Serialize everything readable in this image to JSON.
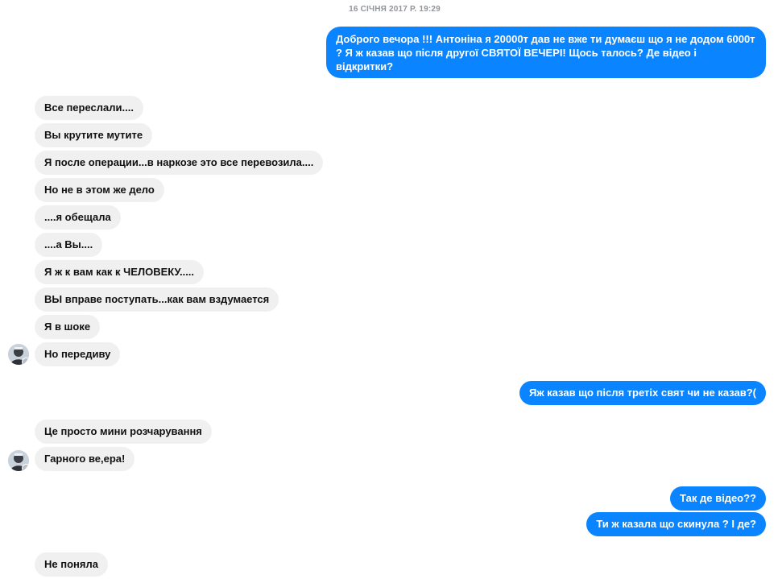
{
  "conversation": {
    "timestamp": "16 СІЧНЯ 2017 Р. 19:29",
    "messages": [
      {
        "from": "me",
        "text": "Доброго вечора !!! Антоніна я 20000т дав не вже ти думаєш що я не додом 6000т ? Я ж казав що після другої СВЯТОЇ ВЕЧЕРІ! Щось талось? Де відео і відкритки?"
      },
      {
        "from": "contact",
        "text": "Все переслали...."
      },
      {
        "from": "contact",
        "text": "Вы крутите мутите"
      },
      {
        "from": "contact",
        "text": "Я после операции...в наркозе это все перевозила...."
      },
      {
        "from": "contact",
        "text": "Но не в этом же дело"
      },
      {
        "from": "contact",
        "text": "....я обещала"
      },
      {
        "from": "contact",
        "text": "....а Вы...."
      },
      {
        "from": "contact",
        "text": "Я ж к вам как к ЧЕЛОВЕКУ....."
      },
      {
        "from": "contact",
        "text": "ВЫ вправе поступать...как вам вздумается"
      },
      {
        "from": "contact",
        "text": "Я в шоке"
      },
      {
        "from": "contact",
        "text": "Но передиву"
      },
      {
        "from": "me",
        "text": "Яж казав що після третіх свят чи не казав?("
      },
      {
        "from": "contact",
        "text": "Це просто мини розчарування"
      },
      {
        "from": "contact",
        "text": "Гарного ве,ера!"
      },
      {
        "from": "me",
        "text": "Так де відео??"
      },
      {
        "from": "me",
        "text": "Ти ж казала що скинула ?  І де?"
      },
      {
        "from": "contact",
        "text": "Не поняла"
      }
    ]
  },
  "colors": {
    "outgoing_bubble": "#0a84ff",
    "incoming_bubble": "#f1f0f0",
    "timestamp_text": "#90949c"
  },
  "icons": {
    "avatar": "contact-avatar-icon",
    "badge": "messenger-badge-icon"
  }
}
